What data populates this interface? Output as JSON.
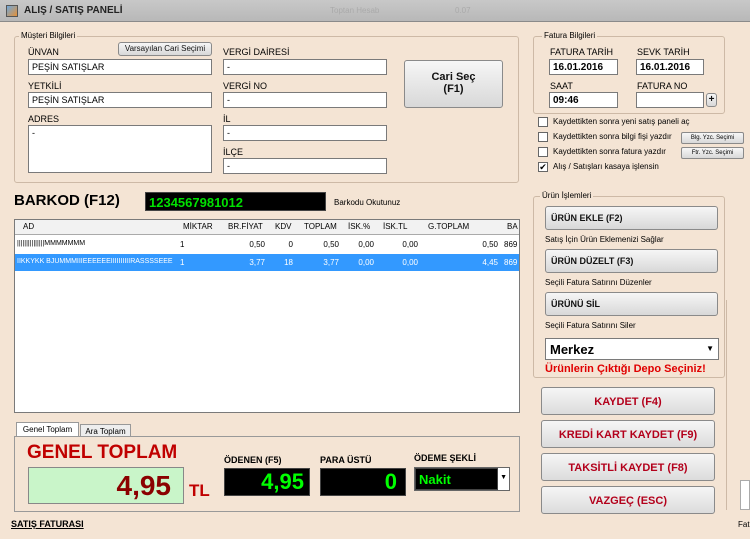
{
  "window": {
    "title": "ALIŞ / SATIŞ PANELİ",
    "ghost1": "Toptan Hesab",
    "ghost2": "0.07"
  },
  "customer": {
    "group_label": "Müşteri Bilgileri",
    "unvan_label": "ÜNVAN",
    "unvan_value": "PEŞİN SATIŞLAR",
    "default_button": "Varsayılan Cari Seçimi",
    "yetkili_label": "YETKİLİ",
    "yetkili_value": "PEŞİN SATIŞLAR",
    "adres_label": "ADRES",
    "adres_value": "-",
    "vergi_dairesi_label": "VERGİ DAİRESİ",
    "vergi_dairesi_value": "-",
    "vergi_no_label": "VERGİ NO",
    "vergi_no_value": "-",
    "il_label": "İL",
    "il_value": "-",
    "ilce_label": "İLÇE",
    "ilce_value": "-",
    "cari_sec_line1": "Cari Seç",
    "cari_sec_line2": "(F1)"
  },
  "invoice": {
    "group_label": "Fatura Bilgileri",
    "fatura_tarih_label": "FATURA TARİH",
    "fatura_tarih_value": "16.01.2016",
    "sevk_tarih_label": "SEVK TARİH",
    "sevk_tarih_value": "16.01.2016",
    "saat_label": "SAAT",
    "saat_value": "09:46",
    "fatura_no_label": "FATURA NO",
    "fatura_no_value": "",
    "plus_label": "+"
  },
  "options": [
    {
      "label": "Kaydettikten sonra yeni satış paneli aç",
      "checked": false
    },
    {
      "label": "Kaydettikten sonra bilgi fişi yazdır",
      "checked": false,
      "button": "Blg. Yzc. Seçimi"
    },
    {
      "label": "Kaydettikten sonra fatura yazdır",
      "checked": false,
      "button": "Ftr. Yzc. Seçimi"
    },
    {
      "label": "Alış / Satışları kasaya işlensin",
      "checked": true
    }
  ],
  "barcode": {
    "label": "BARKOD (F12)",
    "value": "1234567981012",
    "hint": "Barkodu Okutunuz"
  },
  "grid": {
    "columns": [
      "AD",
      "MİKTAR",
      "BR.FİYAT",
      "KDV",
      "TOPLAM",
      "İSK.%",
      "İSK.TL",
      "G.TOPLAM",
      "BA"
    ],
    "rows": [
      {
        "ad": "|||||||||||||||MMMMMMM",
        "miktar": "1",
        "br_fiyat": "0,50",
        "kdv": "0",
        "toplam": "0,50",
        "isk_pct": "0,00",
        "isk_tl": "0,00",
        "g_toplam": "0,50",
        "ba": "869"
      },
      {
        "ad": "IIKKYKK BJUMMMIIIEEEEEEIIIIIIIIIIRASSSSEEE",
        "miktar": "1",
        "br_fiyat": "3,77",
        "kdv": "18",
        "toplam": "3,77",
        "isk_pct": "0,00",
        "isk_tl": "0,00",
        "g_toplam": "4,45",
        "ba": "869"
      }
    ]
  },
  "product_ops": {
    "group_label": "Ürün İşlemleri",
    "add_button": "ÜRÜN EKLE (F2)",
    "add_desc": "Satış İçin Ürün Eklemenizi Sağlar",
    "edit_button": "ÜRÜN DÜZELT (F3)",
    "edit_desc": "Seçili Fatura Satırını Düzenler",
    "delete_button": "ÜRÜNÜ SİL",
    "delete_desc": "Seçili Fatura Satırını Siler",
    "depot_value": "Merkez",
    "depot_warning": "Ürünlerin Çıktığı Depo Seçiniz!"
  },
  "tabs": [
    "Genel Toplam",
    "Ara Toplam"
  ],
  "totals": {
    "genel_toplam_label": "GENEL TOPLAM",
    "genel_toplam_value": "4,95",
    "currency": "TL",
    "odenen_label": "ÖDENEN (F5)",
    "odenen_value": "4,95",
    "para_ustu_label": "PARA ÜSTÜ",
    "para_ustu_value": "0",
    "odeme_sekli_label": "ÖDEME ŞEKLİ",
    "odeme_sekli_value": "Nakit"
  },
  "actions": {
    "save": "KAYDET (F4)",
    "card_save": "KREDİ KART KAYDET (F9)",
    "installment_save": "TAKSİTLİ KAYDET (F8)",
    "cancel": "VAZGEÇ (ESC)"
  },
  "footer": {
    "doc_type": "SATIŞ FATURASI",
    "partial_right": "Fatu"
  },
  "colors": {
    "background": "#f4e4d4",
    "selection": "#3399ff",
    "accent_red": "#b3001b",
    "total_green": "#c9f5c9",
    "digital_green": "#00ff00"
  }
}
